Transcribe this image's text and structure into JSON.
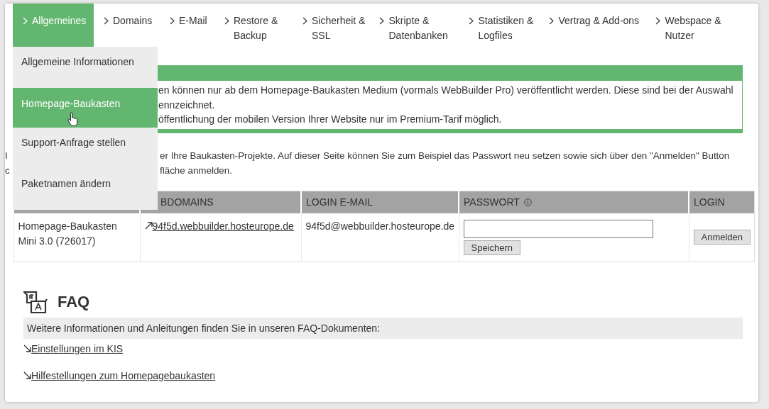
{
  "nav": {
    "tabs": [
      {
        "label": "Allgemeines",
        "selected": true
      },
      {
        "label": "Domains",
        "selected": false
      },
      {
        "label": "E-Mail",
        "selected": false
      },
      {
        "label": "Restore &\nBackup",
        "selected": false
      },
      {
        "label": "Sicherheit &\nSSL",
        "selected": false
      },
      {
        "label": "Skripte &\nDatenbanken",
        "selected": false
      },
      {
        "label": "Statistiken &\nLogfiles",
        "selected": false
      },
      {
        "label": "Vertrag & Add-ons",
        "selected": false
      },
      {
        "label": "Webspace &\nNutzer",
        "selected": false
      }
    ]
  },
  "dropdown": {
    "items": [
      {
        "label": "Allgemeine Informationen",
        "selected": false
      },
      {
        "label": "Homepage-Baukasten",
        "selected": true
      },
      {
        "label": "Support-Anfrage stellen",
        "selected": false
      },
      {
        "label": "Paketnamen ändern",
        "selected": false
      }
    ]
  },
  "notice": {
    "lines": [
      "en können nur ab dem Homepage-Baukasten Medium (vormals WebBuilder Pro) veröffentlicht werden. Diese sind bei der Auswahl",
      "ennzeichnet.",
      "öffentlichung der mobilen Version Ihrer Website nur im Premium-Tarif möglich."
    ]
  },
  "intro": {
    "lines": [
      {
        "lead": "I",
        "text": "er Ihre Baukasten-Projekte. Auf dieser Seite können Sie zum Beispiel das Passwort neu setzen sowie sich über den \"Anmelden\" Button"
      },
      {
        "lead": "c",
        "text": "fläche anmelden."
      }
    ]
  },
  "table": {
    "columns": [
      "BDOMAINS",
      "LOGIN E-MAIL",
      "PASSWORT",
      "LOGIN"
    ],
    "rows": [
      {
        "package": "Homepage-Baukasten Mini 3.0 (726017)",
        "domain": "94f5d.webbuilder.hosteurope.de",
        "email": "94f5d@webbuilder.hosteurope.de",
        "save_button": "Speichern",
        "login_button": "Anmelden"
      }
    ]
  },
  "faq": {
    "title": "FAQ",
    "info": "Weitere Informationen und Anleitungen finden Sie in unseren FAQ-Dokumenten:",
    "links": [
      "Einstellungen im KIS",
      "Hilfestellungen zum Homepagebaukasten"
    ]
  }
}
